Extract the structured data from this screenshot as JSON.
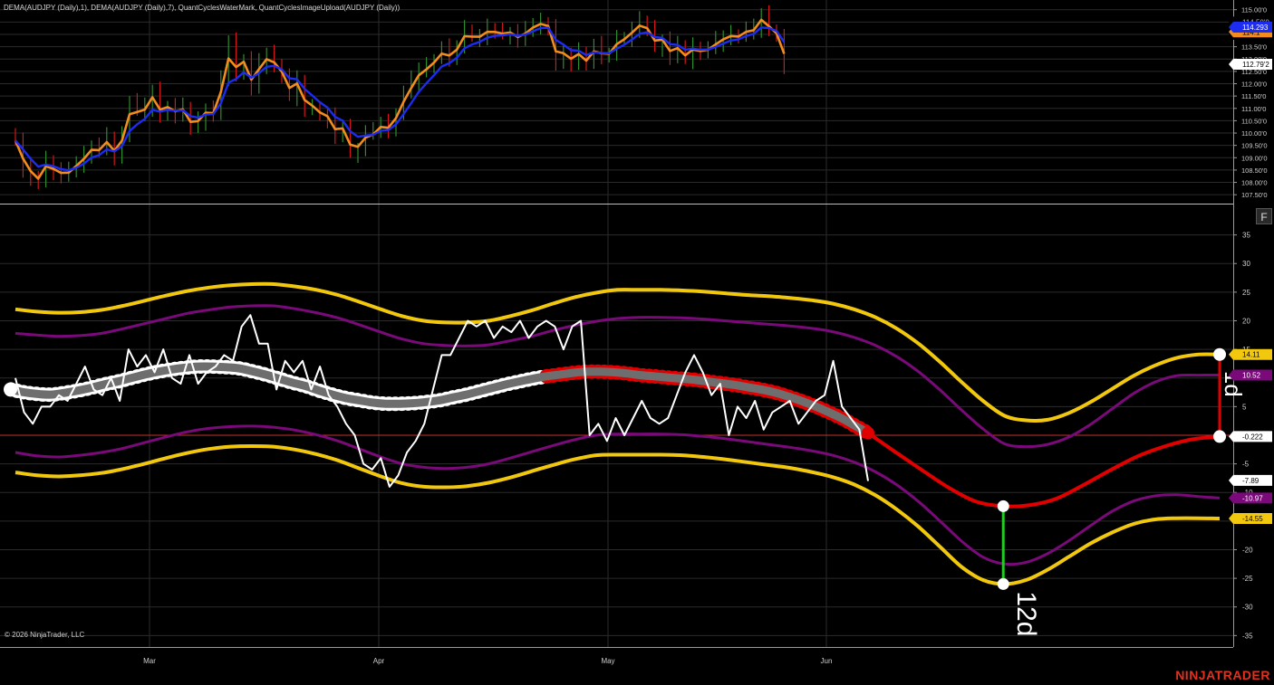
{
  "header": {
    "indicators_title": "DEMA(AUDJPY (Daily),1), DEMA(AUDJPY (Daily),7), QuantCyclesWaterMark, QuantCyclesImageUpload(AUDJPY (Daily))"
  },
  "footer": {
    "copyright": "© 2026 NinjaTrader, LLC",
    "brand": "NINJATRADER",
    "brand_color": "#e0321e"
  },
  "toolbar": {
    "f_button": "F"
  },
  "colors": {
    "bull": "#2e8b2e",
    "bear": "#d01818",
    "dema_fast": "#f28c1e",
    "dema_slow": "#1c2cf0",
    "grid": "#2b2b2b",
    "yellow": "#f2c80f",
    "purple": "#7a0a7a",
    "cycle_gray": "#6e6e6e",
    "projection": "#e00000",
    "oscillator": "#ffffff",
    "zero_line": "#c83232",
    "green_marker": "#22cc22",
    "axis_text": "#cfcfcf"
  },
  "chart_data": [
    {
      "type": "candlestick",
      "title": "",
      "symbol_series": [
        "DEMA(AUDJPY (Daily),1)",
        "DEMA(AUDJPY (Daily),7)"
      ],
      "x_labels": [
        "Mar",
        "Apr",
        "May",
        "Jun"
      ],
      "ylim": [
        107.25,
        115.1
      ],
      "y_ticks": [
        "115.00'0",
        "114.50'0",
        "114.00'0",
        "113.50'0",
        "113.00'0",
        "112.50'0",
        "112.00'0",
        "111.50'0",
        "111.00'0",
        "110.50'0",
        "110.00'0",
        "109.50'0",
        "109.00'0",
        "108.50'0",
        "108.00'0",
        "107.50'0"
      ],
      "closes": [
        109.7,
        108.6,
        108.2,
        108.0,
        108.9,
        108.5,
        108.3,
        108.4,
        108.8,
        109.1,
        109.5,
        109.3,
        109.8,
        109.1,
        109.9,
        111.3,
        110.9,
        111.0,
        111.7,
        110.7,
        111.1,
        110.8,
        111.0,
        110.2,
        110.5,
        111.0,
        110.8,
        112.1,
        113.7,
        112.5,
        113.0,
        111.8,
        112.8,
        113.2,
        112.8,
        112.3,
        111.5,
        112.1,
        111.0,
        111.0,
        110.7,
        110.6,
        109.9,
        110.2,
        109.2,
        109.4,
        110.0,
        110.0,
        110.4,
        110.2,
        110.8,
        111.6,
        112.1,
        112.6,
        112.7,
        113.0,
        113.4,
        113.1,
        113.5,
        114.2,
        113.9,
        113.9,
        114.2,
        114.1,
        114.0,
        114.1,
        113.8,
        114.1,
        114.4,
        114.5,
        114.3,
        112.8,
        113.2,
        112.9,
        113.3,
        112.8,
        113.5,
        113.2,
        113.2,
        113.8,
        113.9,
        114.2,
        114.5,
        114.2,
        113.5,
        113.8,
        113.1,
        113.5,
        113.0,
        113.5,
        113.3,
        113.4,
        113.7,
        113.9,
        114.0,
        113.9,
        114.2,
        114.2,
        114.8,
        114.2,
        113.9,
        112.8
      ],
      "dema_fast_value": "114.293",
      "dema_slow_value": "114.1",
      "last_price": "112.79'2",
      "label_value_a": "114.50'0",
      "label_value_b": "114.00'0"
    },
    {
      "type": "line",
      "title": "",
      "ylim": [
        -37,
        40
      ],
      "y_ticks": [
        "35",
        "30",
        "25",
        "20",
        "15",
        "10",
        "5",
        "0",
        "-5",
        "-10",
        "-15",
        "-20",
        "-25",
        "-30",
        "-35"
      ],
      "oscillator": [
        10,
        4,
        2,
        5,
        5,
        7,
        6,
        9,
        12,
        8,
        7,
        10,
        6,
        15,
        12,
        14,
        11,
        15,
        10,
        9,
        14,
        9,
        11,
        12,
        14,
        13,
        19,
        21,
        16,
        16,
        8,
        13,
        11,
        13,
        8,
        12,
        7,
        5,
        2,
        0,
        -5,
        -6,
        -4,
        -9,
        -7,
        -3,
        -1,
        2,
        8,
        14,
        14,
        17,
        20,
        19,
        20,
        17,
        19,
        18,
        20,
        17,
        19,
        20,
        19,
        15,
        19,
        20,
        0,
        2,
        -1,
        3,
        0,
        3,
        6,
        3,
        2,
        3,
        7,
        11,
        14,
        11,
        7,
        9,
        0,
        5,
        3,
        6,
        1,
        4,
        5,
        6,
        2,
        4,
        6,
        7,
        13,
        5,
        3,
        1,
        -8
      ],
      "cycle_center": [
        8.0,
        7.5,
        7.2,
        7.1,
        7.4,
        7.8,
        8.3,
        8.9,
        9.4,
        10.0,
        10.6,
        11.1,
        11.5,
        11.8,
        12.0,
        12.0,
        11.9,
        11.7,
        11.2,
        10.6,
        9.9,
        9.2,
        8.6,
        7.8,
        7.1,
        6.5,
        6.1,
        5.7,
        5.5,
        5.5,
        5.6,
        5.8,
        6.1,
        6.6,
        7.1,
        7.7,
        8.3,
        8.9,
        9.4,
        9.9,
        10.3,
        10.6,
        10.9,
        11.1,
        11.1,
        11.0,
        10.8,
        10.5,
        10.3,
        10.1,
        9.9,
        9.7,
        9.4,
        9.1,
        8.8,
        8.4,
        8.0,
        7.5,
        6.8,
        6.0,
        5.1,
        4.1,
        3.0,
        1.7,
        0.4
      ],
      "projection": [
        0.4,
        -2.9,
        -6.1,
        -9.2,
        -11.6,
        -12.4,
        -12.2,
        -11.0,
        -8.6,
        -6.0,
        -3.6,
        -1.9,
        -0.7,
        -0.222
      ],
      "upper_outer": [
        22,
        21.6,
        21.4,
        21.5,
        21.9,
        22.6,
        23.5,
        24.4,
        25.2,
        25.8,
        26.2,
        26.4,
        26.4,
        26.0,
        25.4,
        24.5,
        23.3,
        22.0,
        20.8,
        20.0,
        19.7,
        19.7,
        20.0,
        20.8,
        21.8,
        23.0,
        24.1,
        24.9,
        25.4,
        25.4,
        25.4,
        25.3,
        25.1,
        24.8,
        24.5,
        24.3,
        24.0,
        23.6,
        23.0,
        22.0,
        20.6,
        18.6,
        16.0,
        12.8,
        9.3,
        6.0,
        3.4,
        2.6,
        2.7,
        3.9,
        5.8,
        8.1,
        10.4,
        12.2,
        13.5,
        14.1,
        14.11
      ],
      "upper_inner": [
        17.8,
        17.5,
        17.3,
        17.4,
        17.8,
        18.6,
        19.5,
        20.4,
        21.3,
        21.9,
        22.4,
        22.6,
        22.6,
        22.1,
        21.4,
        20.5,
        19.3,
        18.0,
        16.8,
        16.0,
        15.7,
        15.6,
        15.8,
        16.5,
        17.3,
        18.3,
        19.2,
        19.9,
        20.4,
        20.6,
        20.6,
        20.5,
        20.3,
        20.0,
        19.7,
        19.4,
        19.1,
        18.7,
        18.1,
        17.1,
        15.7,
        13.7,
        11.1,
        7.9,
        4.4,
        1.1,
        -1.5,
        -2.0,
        -1.6,
        -0.3,
        1.9,
        4.6,
        7.3,
        9.3,
        10.4,
        10.5,
        10.52
      ],
      "lower_inner": [
        -3.0,
        -3.6,
        -3.8,
        -3.5,
        -3.0,
        -2.3,
        -1.3,
        -0.3,
        0.6,
        1.2,
        1.5,
        1.6,
        1.4,
        0.9,
        0.1,
        -1.0,
        -2.4,
        -3.8,
        -5.0,
        -5.6,
        -5.8,
        -5.6,
        -5.0,
        -4.0,
        -2.9,
        -1.8,
        -0.8,
        0,
        0.2,
        0.2,
        0.2,
        0.1,
        -0.2,
        -0.6,
        -1.1,
        -1.6,
        -2.1,
        -2.7,
        -3.5,
        -4.7,
        -6.4,
        -8.7,
        -11.6,
        -15.0,
        -18.5,
        -21.3,
        -22.5,
        -22.2,
        -20.7,
        -18.4,
        -15.8,
        -13.3,
        -11.5,
        -10.6,
        -10.4,
        -10.7,
        -10.97
      ],
      "lower_outer": [
        -6.5,
        -7.0,
        -7.2,
        -7.0,
        -6.6,
        -5.9,
        -5.0,
        -4.0,
        -3.1,
        -2.4,
        -2.0,
        -1.9,
        -2.0,
        -2.5,
        -3.3,
        -4.4,
        -5.8,
        -7.2,
        -8.4,
        -9.0,
        -9.1,
        -8.9,
        -8.3,
        -7.4,
        -6.3,
        -5.2,
        -4.2,
        -3.5,
        -3.4,
        -3.4,
        -3.4,
        -3.5,
        -3.8,
        -4.2,
        -4.7,
        -5.2,
        -5.7,
        -6.4,
        -7.3,
        -8.6,
        -10.5,
        -13.0,
        -16.0,
        -19.5,
        -23.0,
        -25.3,
        -26.0,
        -25.3,
        -23.5,
        -21.2,
        -18.9,
        -17.0,
        -15.5,
        -14.7,
        -14.5,
        -14.5,
        -14.55
      ],
      "value_labels": {
        "upper_outer": "14.11",
        "upper_inner": "10.52",
        "projection": "-0.222",
        "oscillator": "-7.89",
        "lower_inner": "-10.97",
        "lower_outer": "-14.55"
      },
      "annotations": {
        "cycle_length": "12d",
        "right_marker": "1d"
      }
    }
  ]
}
